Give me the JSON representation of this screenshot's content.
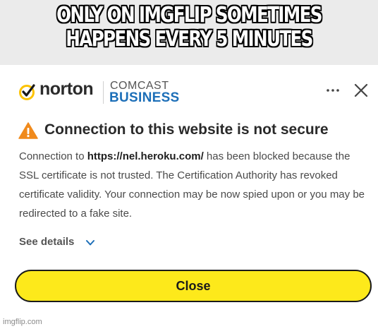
{
  "meme": {
    "line1": "ONLY ON IMGFLIP SOMETIMES",
    "line2": "HAPPENS EVERY 5 MINUTES"
  },
  "header": {
    "brand": "norton",
    "partner_top": "COMCAST",
    "partner_bottom": "BUSINESS",
    "menu_icon": "more-horizontal-icon",
    "close_icon": "close-icon"
  },
  "alert": {
    "icon": "warning-triangle-icon",
    "title": "Connection to this website is not secure",
    "text_before": "Connection to ",
    "url": "https://nel.heroku.com/",
    "text_after": " has been blocked because the SSL certificate is not trusted. The Certification Authority has revoked certificate validity. Your connection may be now spied upon or you may be redirected to a fake site."
  },
  "details": {
    "label": "See details",
    "icon": "chevron-down-icon"
  },
  "actions": {
    "close_label": "Close"
  },
  "watermark": "imgflip.com",
  "colors": {
    "norton_yellow": "#fde91b",
    "business_blue": "#1d6fb8",
    "warning_orange": "#f08a1c"
  }
}
